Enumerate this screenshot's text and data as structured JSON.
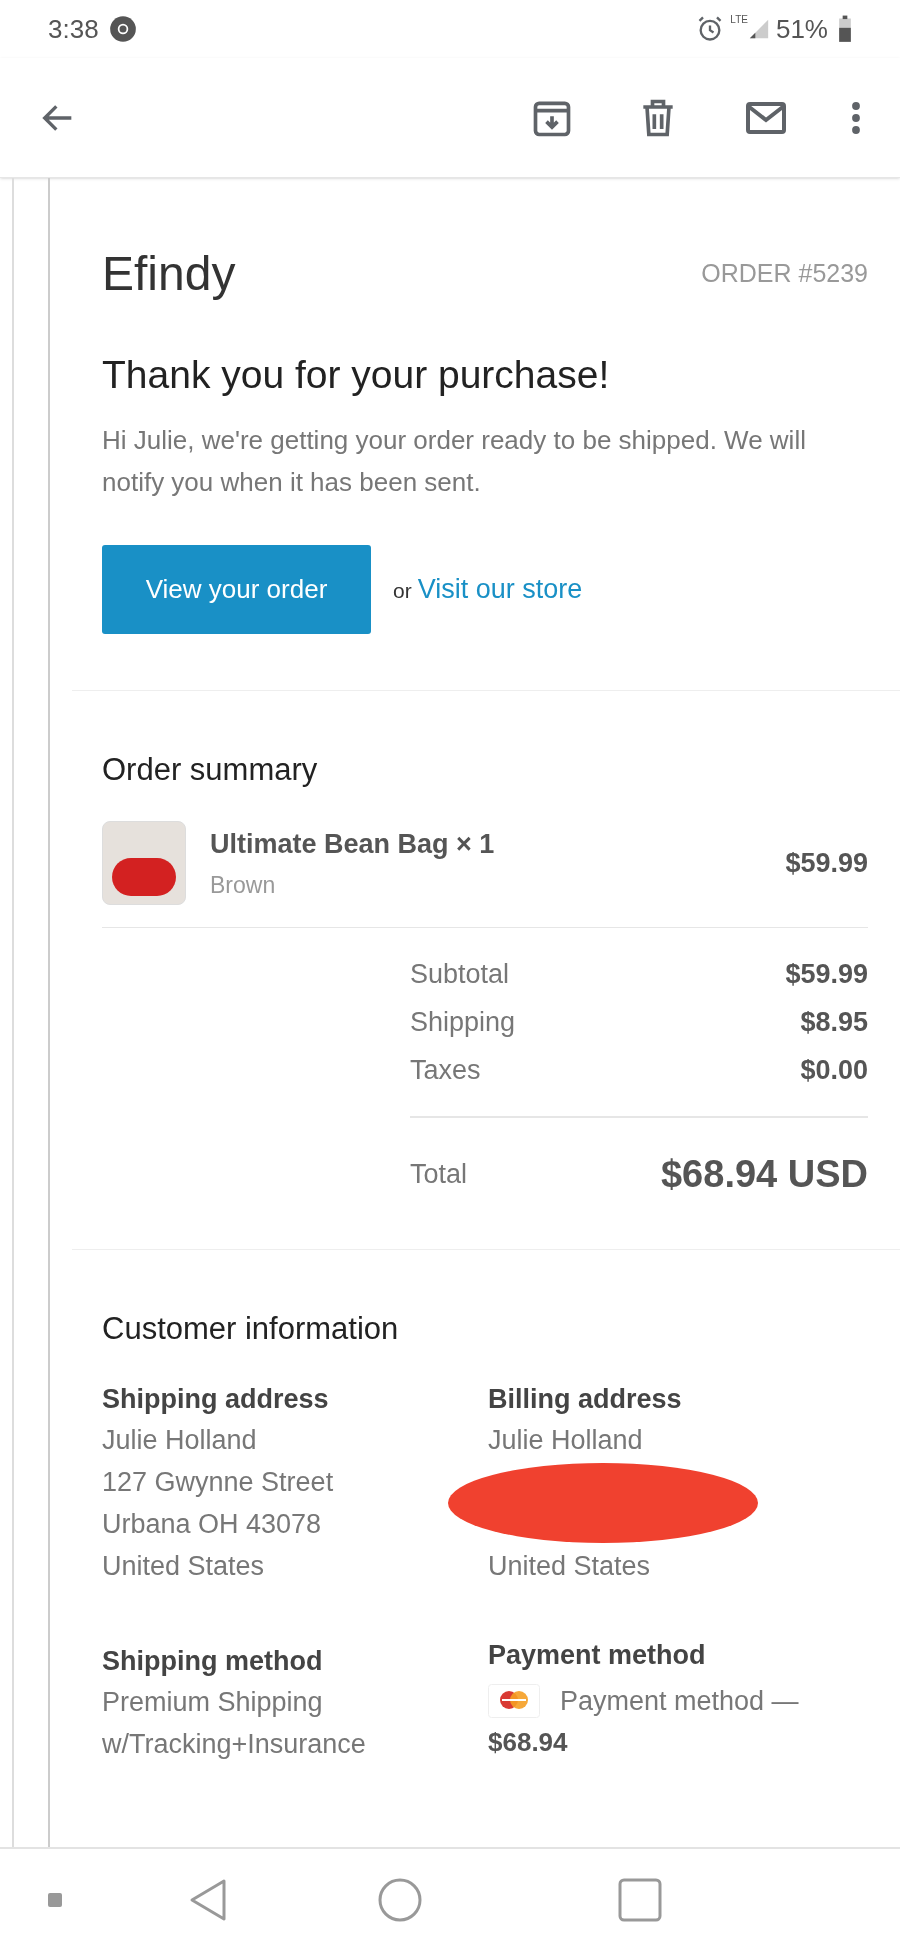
{
  "status_bar": {
    "time": "3:38",
    "network": "LTE",
    "battery": "51%"
  },
  "email": {
    "brand": "Efindy",
    "order_number": "ORDER #5239",
    "heading": "Thank you for your purchase!",
    "message": "Hi Julie, we're getting your order ready to be shipped. We will notify you when it has been sent.",
    "primary_button": "View your order",
    "or_text": "or",
    "store_link": "Visit our store"
  },
  "order_summary": {
    "title": "Order summary",
    "items": [
      {
        "name": "Ultimate Bean Bag × 1",
        "variant": "Brown",
        "price": "$59.99"
      }
    ],
    "lines": [
      {
        "label": "Subtotal",
        "value": "$59.99"
      },
      {
        "label": "Shipping",
        "value": "$8.95"
      },
      {
        "label": "Taxes",
        "value": "$0.00"
      }
    ],
    "total": {
      "label": "Total",
      "value": "$68.94 USD"
    }
  },
  "customer_information": {
    "title": "Customer information",
    "shipping_address": {
      "title": "Shipping address",
      "lines": [
        "Julie Holland",
        "127 Gwynne Street",
        "Urbana OH 43078",
        "United States"
      ]
    },
    "billing_address": {
      "title": "Billing address",
      "lines": [
        "Julie Holland",
        "United States"
      ]
    },
    "shipping_method": {
      "title": "Shipping method",
      "lines": [
        "Premium Shipping",
        "w/Tracking+Insurance"
      ]
    },
    "payment_method": {
      "title": "Payment method",
      "text": "Payment method —",
      "amount": "$68.94"
    }
  }
}
